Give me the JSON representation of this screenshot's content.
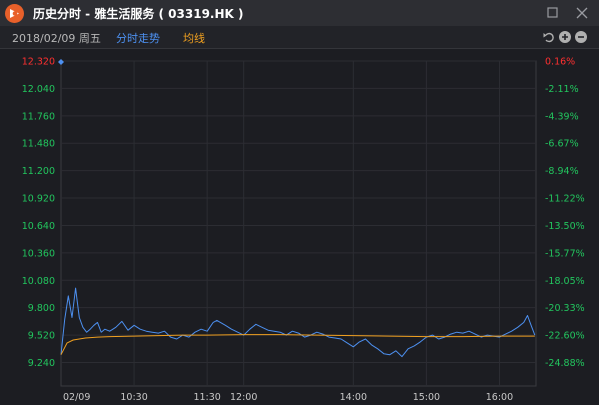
{
  "window": {
    "title": "历史分时 - 雅生活服务 ( 03319.HK )"
  },
  "toolbar": {
    "date": "2018/02/09 周五",
    "intraday_label": "分时走势",
    "avg_label": "均线"
  },
  "icons": {
    "logo": "app-logo-icon",
    "maximize": "maximize-icon",
    "close": "close-icon",
    "undo": "undo-icon",
    "zoom_in": "zoom-in-icon",
    "zoom_out": "zoom-out-icon"
  },
  "colors": {
    "price_line": "#4d90f0",
    "avg_line": "#f0a020",
    "up": "#ff3030",
    "down": "#22c55e",
    "intraday_label": "#4d90f0",
    "avg_label": "#f0a020"
  },
  "chart_data": {
    "type": "line",
    "price_ticks": [
      "12.320",
      "12.040",
      "11.760",
      "11.480",
      "11.200",
      "10.920",
      "10.640",
      "10.360",
      "10.080",
      "9.800",
      "9.520",
      "9.240"
    ],
    "percent_ticks": [
      "0.16%",
      "-2.11%",
      "-4.39%",
      "-6.67%",
      "-8.94%",
      "-11.22%",
      "-13.50%",
      "-15.77%",
      "-18.05%",
      "-20.33%",
      "-22.60%",
      "-24.88%"
    ],
    "ylim": [
      9.0,
      12.32
    ],
    "x_ticks": [
      "02/09",
      "10:30",
      "11:30",
      "12:00",
      "14:00",
      "15:00",
      "16:00"
    ],
    "x_tick_minutes": [
      0,
      60,
      120,
      150,
      240,
      300,
      360
    ],
    "x_range_minutes": [
      0,
      390
    ],
    "grid": true,
    "series": [
      {
        "key": "price",
        "x": [
          0,
          3,
          6,
          9,
          12,
          13,
          15,
          18,
          21,
          24,
          27,
          30,
          33,
          36,
          40,
          45,
          50,
          55,
          60,
          65,
          70,
          75,
          80,
          85,
          90,
          95,
          100,
          105,
          110,
          115,
          120,
          125,
          128,
          135,
          140,
          150,
          155,
          160,
          165,
          170,
          175,
          180,
          185,
          190,
          195,
          200,
          205,
          210,
          215,
          220,
          225,
          230,
          235,
          240,
          245,
          250,
          255,
          260,
          265,
          270,
          275,
          280,
          285,
          290,
          295,
          300,
          305,
          310,
          315,
          320,
          325,
          330,
          335,
          340,
          345,
          350,
          355,
          360,
          365,
          370,
          375,
          380,
          383,
          386,
          389
        ],
        "y": [
          9.32,
          9.68,
          9.92,
          9.7,
          10.0,
          9.9,
          9.7,
          9.6,
          9.55,
          9.58,
          9.62,
          9.65,
          9.55,
          9.58,
          9.56,
          9.6,
          9.66,
          9.57,
          9.62,
          9.58,
          9.56,
          9.55,
          9.54,
          9.56,
          9.5,
          9.48,
          9.52,
          9.5,
          9.55,
          9.58,
          9.56,
          9.65,
          9.67,
          9.62,
          9.58,
          9.52,
          9.58,
          9.63,
          9.6,
          9.57,
          9.56,
          9.55,
          9.52,
          9.56,
          9.54,
          9.5,
          9.52,
          9.55,
          9.53,
          9.5,
          9.49,
          9.48,
          9.44,
          9.4,
          9.45,
          9.48,
          9.42,
          9.38,
          9.33,
          9.32,
          9.36,
          9.3,
          9.38,
          9.41,
          9.45,
          9.5,
          9.52,
          9.48,
          9.5,
          9.53,
          9.55,
          9.54,
          9.56,
          9.53,
          9.5,
          9.52,
          9.51,
          9.5,
          9.53,
          9.56,
          9.6,
          9.65,
          9.72,
          9.62,
          9.52
        ]
      },
      {
        "key": "average",
        "x": [
          0,
          5,
          10,
          15,
          20,
          30,
          40,
          60,
          80,
          100,
          120,
          150,
          180,
          210,
          240,
          270,
          300,
          330,
          360,
          389
        ],
        "y": [
          9.32,
          9.44,
          9.47,
          9.48,
          9.49,
          9.5,
          9.505,
          9.51,
          9.515,
          9.52,
          9.52,
          9.525,
          9.525,
          9.52,
          9.515,
          9.51,
          9.505,
          9.505,
          9.51,
          9.51
        ]
      }
    ]
  }
}
